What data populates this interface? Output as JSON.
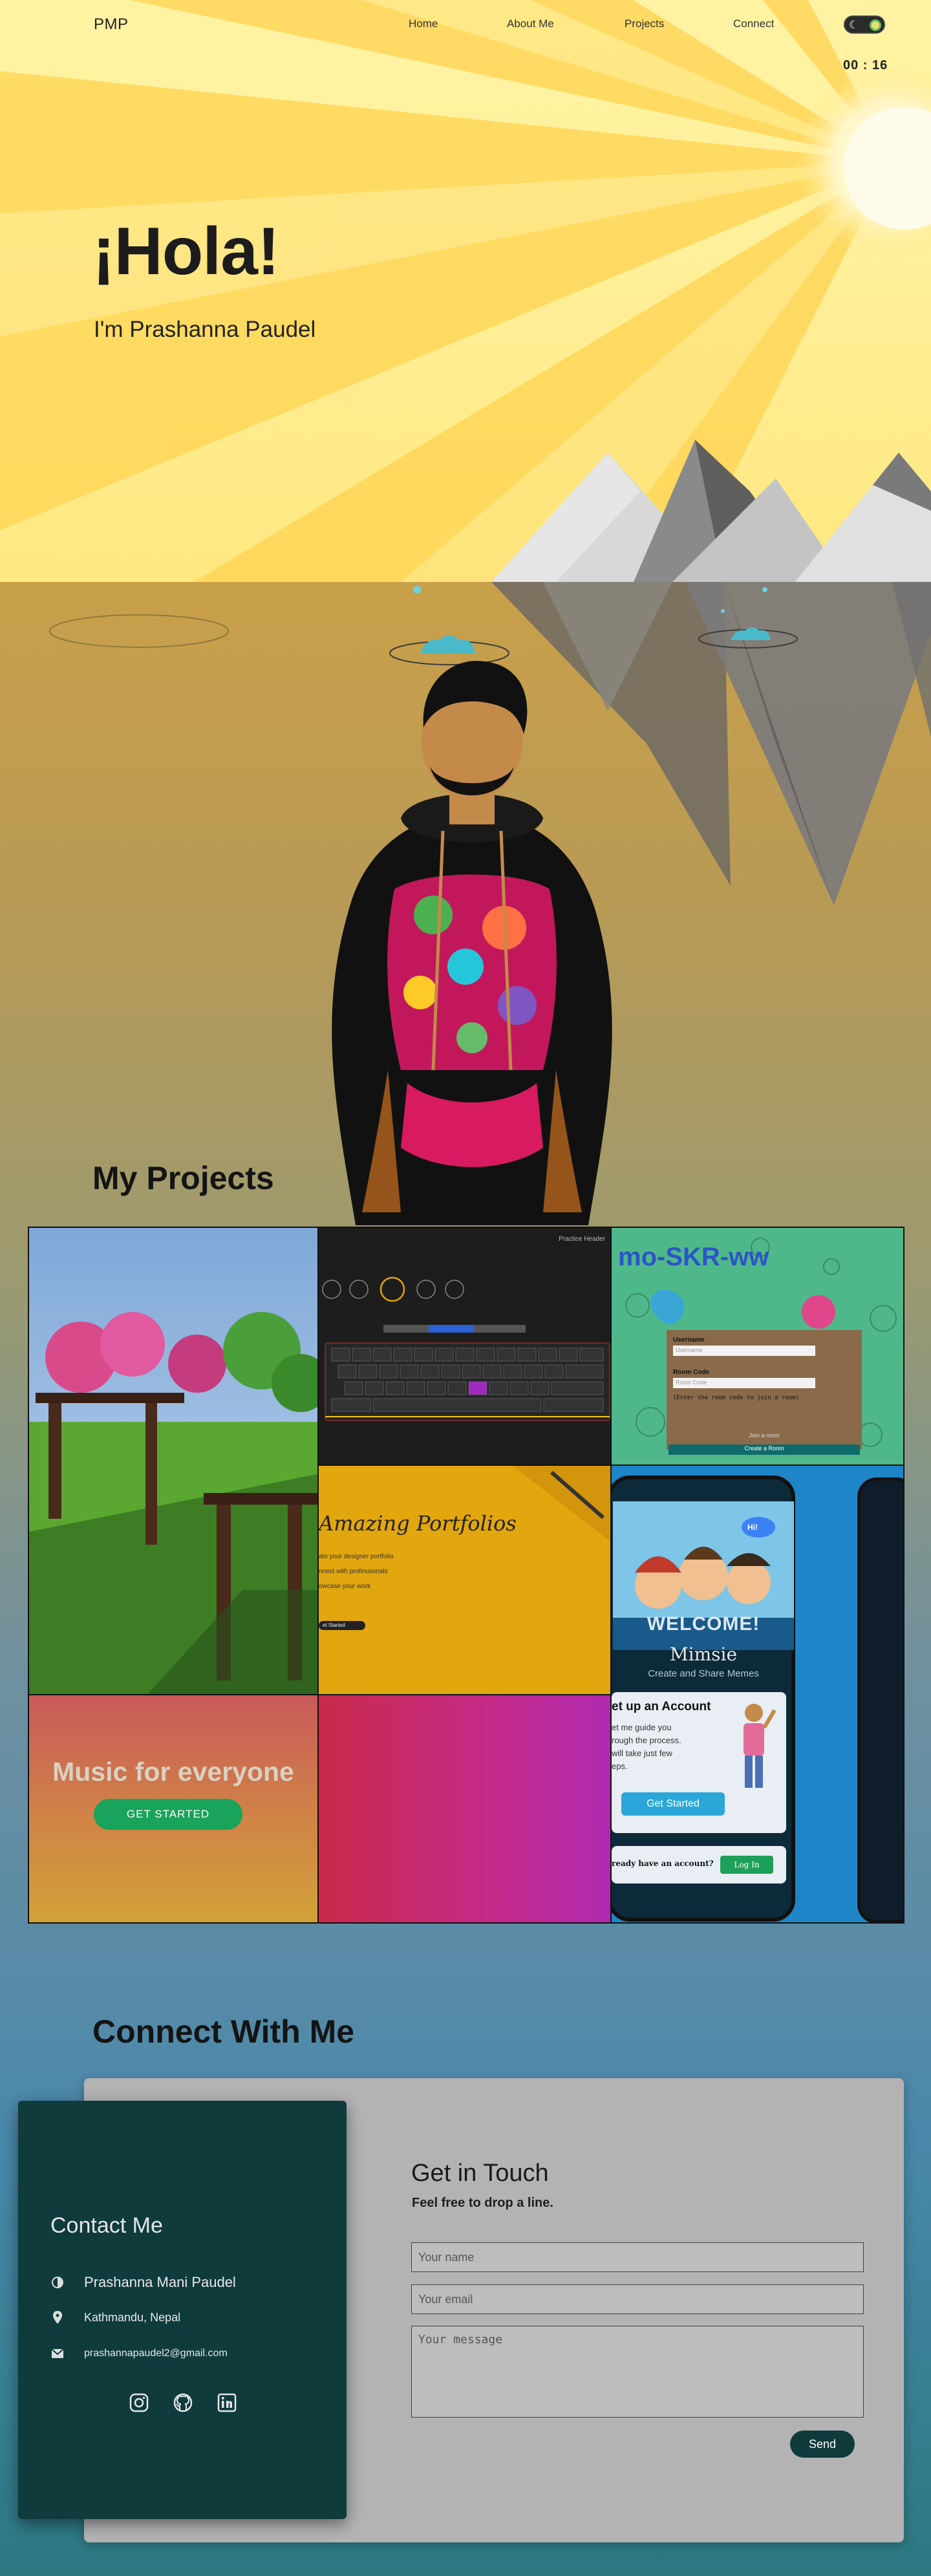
{
  "nav": {
    "logo": "PMP",
    "links": [
      "Home",
      "About Me",
      "Projects",
      "Connect"
    ],
    "timer": "00 : 16",
    "toggle_icon": "moon-icon"
  },
  "hero": {
    "greeting": "¡Hola!",
    "intro": "I'm Prashanna Paudel"
  },
  "projects": {
    "title": "My Projects",
    "tiles": [
      {
        "name": "japanese-garden-3d"
      },
      {
        "name": "typing-practice",
        "header": "Practice Header"
      },
      {
        "name": "skribble-room",
        "username_label": "Username",
        "username_placeholder": "Username",
        "room_label": "Room Code",
        "room_placeholder": "Room Code",
        "hint": "(Enter the room code to join a room)",
        "join": "Join a room",
        "create": "Create a Room"
      },
      {
        "name": "amazing-portfolios",
        "title": "Amazing Portfolios",
        "lines": [
          "ate your designer portfolio",
          "nnect with professionals",
          "owcase your work"
        ],
        "cta": "et Started"
      },
      {
        "name": "mimsie-app",
        "welcome": "WELCOME!",
        "app": "Mimsie",
        "tagline": "Create and Share Memes",
        "setup_title": "et up an Account",
        "setup_lines": [
          "et me guide you",
          "rough the process.",
          "will take just few",
          "eps."
        ],
        "get_started": "Get Started",
        "have_account": "ready have an account?",
        "login": "Log In",
        "bubble": "Hi!"
      },
      {
        "name": "music-landing",
        "title": "Music for everyone",
        "cta": "GET STARTED"
      },
      {
        "name": "gradient-tile"
      }
    ]
  },
  "connect": {
    "title": "Connect With Me",
    "contact": {
      "title": "Contact Me",
      "name": "Prashanna Mani Paudel",
      "location": "Kathmandu, Nepal",
      "email": "prashannapaudel2@gmail.com",
      "socials": [
        "instagram-icon",
        "github-icon",
        "linkedin-icon"
      ]
    },
    "form": {
      "title": "Get in Touch",
      "subtitle": "Feel free to drop a line.",
      "name_placeholder": "Your name",
      "email_placeholder": "Your email",
      "message_placeholder": "Your message",
      "send": "Send"
    }
  },
  "colors": {
    "sky": "#fff09b",
    "contact_card": "#0f3b3d",
    "form_card": "#b3b3b3",
    "cta_green": "#1aa35a"
  }
}
